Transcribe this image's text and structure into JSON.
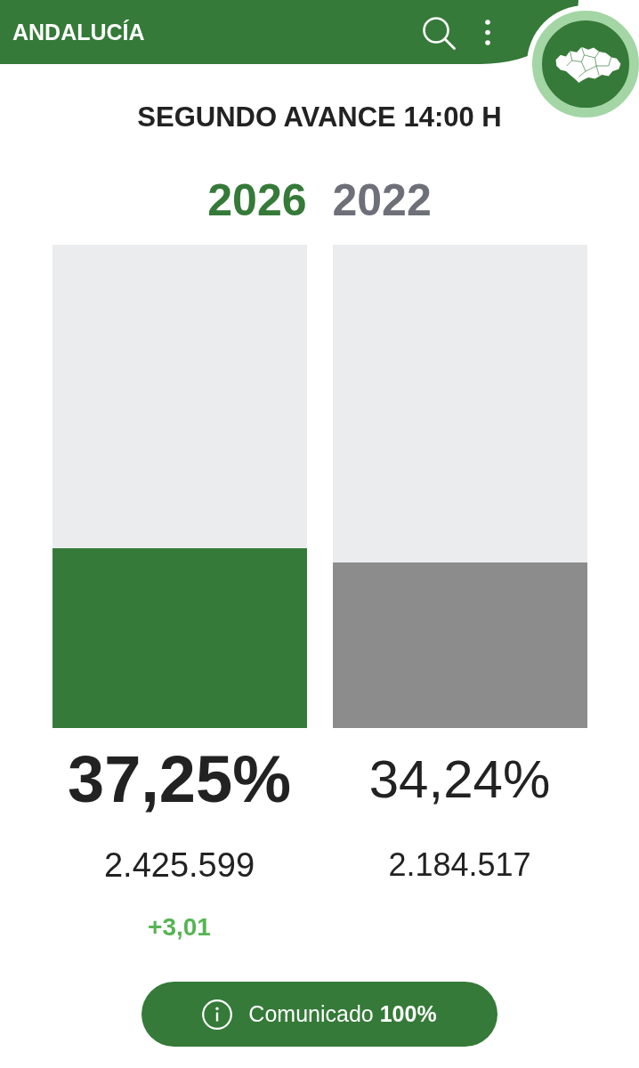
{
  "header": {
    "title": "ANDALUCÍA"
  },
  "subtitle": "SEGUNDO AVANCE 14:00 H",
  "columns": [
    {
      "kind": "current",
      "year": "2026",
      "level": 0.3725,
      "percent": "37,25%",
      "votes": "2.425.599",
      "difference": "+3,01"
    },
    {
      "kind": "previous",
      "year": "2022",
      "level": 0.3424,
      "percent": "34,24%",
      "votes": "2.184.517"
    }
  ],
  "button": {
    "label": "Comunicado **100%**"
  }
}
